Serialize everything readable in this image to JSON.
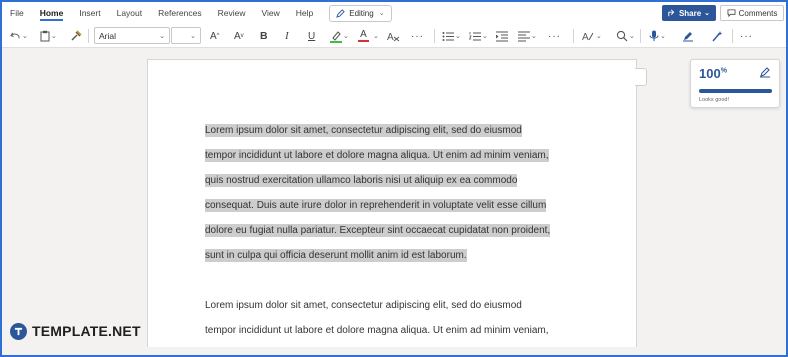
{
  "ribbon": {
    "tabs": [
      {
        "label": "File",
        "active": false
      },
      {
        "label": "Home",
        "active": true
      },
      {
        "label": "Insert",
        "active": false
      },
      {
        "label": "Layout",
        "active": false
      },
      {
        "label": "References",
        "active": false
      },
      {
        "label": "Review",
        "active": false
      },
      {
        "label": "View",
        "active": false
      },
      {
        "label": "Help",
        "active": false
      }
    ],
    "mode_label": "Editing",
    "share_label": "Share",
    "comments_label": "Comments"
  },
  "toolbar": {
    "font_name": "Arial",
    "font_size": "",
    "grow_label": "A",
    "shrink_label": "A",
    "bold_label": "B",
    "italic_label": "I",
    "underline_label": "U",
    "font_color_label": "A",
    "more_label": "···",
    "more2_label": "···",
    "highlight_color": "#3fbf3f",
    "font_color": "#d13438",
    "accent": "#2b579a"
  },
  "document": {
    "selected_paragraph": [
      "Lorem ipsum dolor sit amet, consectetur adipiscing elit, sed do eiusmod",
      "tempor incididunt ut labore et dolore magna aliqua. Ut enim ad minim veniam,",
      "quis nostrud exercitation ullamco laboris nisi ut aliquip ex ea commodo",
      "consequat. Duis aute irure dolor in reprehenderit in voluptate velit esse cillum",
      "dolore eu fugiat nulla pariatur. Excepteur sint occaecat cupidatat non proident,",
      "sunt in culpa qui officia deserunt mollit anim id est laborum."
    ],
    "second_paragraph": [
      "Lorem ipsum dolor sit amet, consectetur adipiscing elit, sed do eiusmod",
      "tempor incididunt ut labore et dolore magna aliqua. Ut enim ad minim veniam,"
    ],
    "selection_color": "#cdcdcd"
  },
  "editor": {
    "score": "100",
    "score_unit": "%",
    "score_fraction": 1.0,
    "message": "Looks good!"
  },
  "brand": {
    "name": "TEMPLATE.NET"
  }
}
